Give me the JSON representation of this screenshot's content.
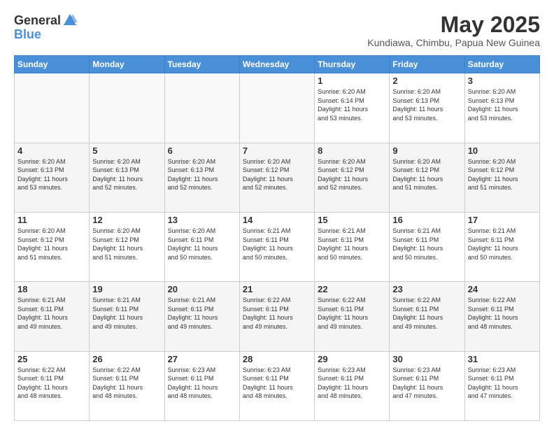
{
  "logo": {
    "general": "General",
    "blue": "Blue"
  },
  "header": {
    "title": "May 2025",
    "subtitle": "Kundiawa, Chimbu, Papua New Guinea"
  },
  "days_of_week": [
    "Sunday",
    "Monday",
    "Tuesday",
    "Wednesday",
    "Thursday",
    "Friday",
    "Saturday"
  ],
  "weeks": [
    [
      {
        "day": "",
        "info": ""
      },
      {
        "day": "",
        "info": ""
      },
      {
        "day": "",
        "info": ""
      },
      {
        "day": "",
        "info": ""
      },
      {
        "day": "1",
        "info": "Sunrise: 6:20 AM\nSunset: 6:14 PM\nDaylight: 11 hours\nand 53 minutes."
      },
      {
        "day": "2",
        "info": "Sunrise: 6:20 AM\nSunset: 6:13 PM\nDaylight: 11 hours\nand 53 minutes."
      },
      {
        "day": "3",
        "info": "Sunrise: 6:20 AM\nSunset: 6:13 PM\nDaylight: 11 hours\nand 53 minutes."
      }
    ],
    [
      {
        "day": "4",
        "info": "Sunrise: 6:20 AM\nSunset: 6:13 PM\nDaylight: 11 hours\nand 53 minutes."
      },
      {
        "day": "5",
        "info": "Sunrise: 6:20 AM\nSunset: 6:13 PM\nDaylight: 11 hours\nand 52 minutes."
      },
      {
        "day": "6",
        "info": "Sunrise: 6:20 AM\nSunset: 6:13 PM\nDaylight: 11 hours\nand 52 minutes."
      },
      {
        "day": "7",
        "info": "Sunrise: 6:20 AM\nSunset: 6:12 PM\nDaylight: 11 hours\nand 52 minutes."
      },
      {
        "day": "8",
        "info": "Sunrise: 6:20 AM\nSunset: 6:12 PM\nDaylight: 11 hours\nand 52 minutes."
      },
      {
        "day": "9",
        "info": "Sunrise: 6:20 AM\nSunset: 6:12 PM\nDaylight: 11 hours\nand 51 minutes."
      },
      {
        "day": "10",
        "info": "Sunrise: 6:20 AM\nSunset: 6:12 PM\nDaylight: 11 hours\nand 51 minutes."
      }
    ],
    [
      {
        "day": "11",
        "info": "Sunrise: 6:20 AM\nSunset: 6:12 PM\nDaylight: 11 hours\nand 51 minutes."
      },
      {
        "day": "12",
        "info": "Sunrise: 6:20 AM\nSunset: 6:12 PM\nDaylight: 11 hours\nand 51 minutes."
      },
      {
        "day": "13",
        "info": "Sunrise: 6:20 AM\nSunset: 6:11 PM\nDaylight: 11 hours\nand 50 minutes."
      },
      {
        "day": "14",
        "info": "Sunrise: 6:21 AM\nSunset: 6:11 PM\nDaylight: 11 hours\nand 50 minutes."
      },
      {
        "day": "15",
        "info": "Sunrise: 6:21 AM\nSunset: 6:11 PM\nDaylight: 11 hours\nand 50 minutes."
      },
      {
        "day": "16",
        "info": "Sunrise: 6:21 AM\nSunset: 6:11 PM\nDaylight: 11 hours\nand 50 minutes."
      },
      {
        "day": "17",
        "info": "Sunrise: 6:21 AM\nSunset: 6:11 PM\nDaylight: 11 hours\nand 50 minutes."
      }
    ],
    [
      {
        "day": "18",
        "info": "Sunrise: 6:21 AM\nSunset: 6:11 PM\nDaylight: 11 hours\nand 49 minutes."
      },
      {
        "day": "19",
        "info": "Sunrise: 6:21 AM\nSunset: 6:11 PM\nDaylight: 11 hours\nand 49 minutes."
      },
      {
        "day": "20",
        "info": "Sunrise: 6:21 AM\nSunset: 6:11 PM\nDaylight: 11 hours\nand 49 minutes."
      },
      {
        "day": "21",
        "info": "Sunrise: 6:22 AM\nSunset: 6:11 PM\nDaylight: 11 hours\nand 49 minutes."
      },
      {
        "day": "22",
        "info": "Sunrise: 6:22 AM\nSunset: 6:11 PM\nDaylight: 11 hours\nand 49 minutes."
      },
      {
        "day": "23",
        "info": "Sunrise: 6:22 AM\nSunset: 6:11 PM\nDaylight: 11 hours\nand 49 minutes."
      },
      {
        "day": "24",
        "info": "Sunrise: 6:22 AM\nSunset: 6:11 PM\nDaylight: 11 hours\nand 48 minutes."
      }
    ],
    [
      {
        "day": "25",
        "info": "Sunrise: 6:22 AM\nSunset: 6:11 PM\nDaylight: 11 hours\nand 48 minutes."
      },
      {
        "day": "26",
        "info": "Sunrise: 6:22 AM\nSunset: 6:11 PM\nDaylight: 11 hours\nand 48 minutes."
      },
      {
        "day": "27",
        "info": "Sunrise: 6:23 AM\nSunset: 6:11 PM\nDaylight: 11 hours\nand 48 minutes."
      },
      {
        "day": "28",
        "info": "Sunrise: 6:23 AM\nSunset: 6:11 PM\nDaylight: 11 hours\nand 48 minutes."
      },
      {
        "day": "29",
        "info": "Sunrise: 6:23 AM\nSunset: 6:11 PM\nDaylight: 11 hours\nand 48 minutes."
      },
      {
        "day": "30",
        "info": "Sunrise: 6:23 AM\nSunset: 6:11 PM\nDaylight: 11 hours\nand 47 minutes."
      },
      {
        "day": "31",
        "info": "Sunrise: 6:23 AM\nSunset: 6:11 PM\nDaylight: 11 hours\nand 47 minutes."
      }
    ]
  ]
}
